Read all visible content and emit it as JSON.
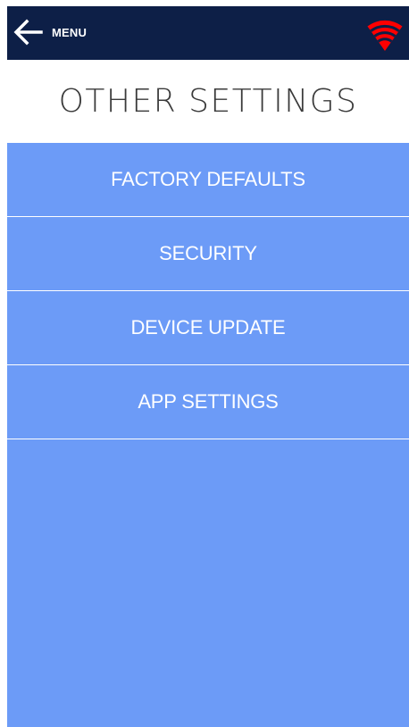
{
  "header": {
    "back_icon": "arrow-left-icon",
    "menu_label": "MENU",
    "wifi_icon": "wifi-icon",
    "wifi_color": "#ff0000",
    "background_color": "#0d1f47"
  },
  "page": {
    "title": "OTHER SETTINGS"
  },
  "menu": {
    "background_color": "#6c9bf7",
    "items": [
      {
        "label": "FACTORY DEFAULTS"
      },
      {
        "label": "SECURITY"
      },
      {
        "label": "DEVICE UPDATE"
      },
      {
        "label": "APP SETTINGS"
      }
    ]
  }
}
